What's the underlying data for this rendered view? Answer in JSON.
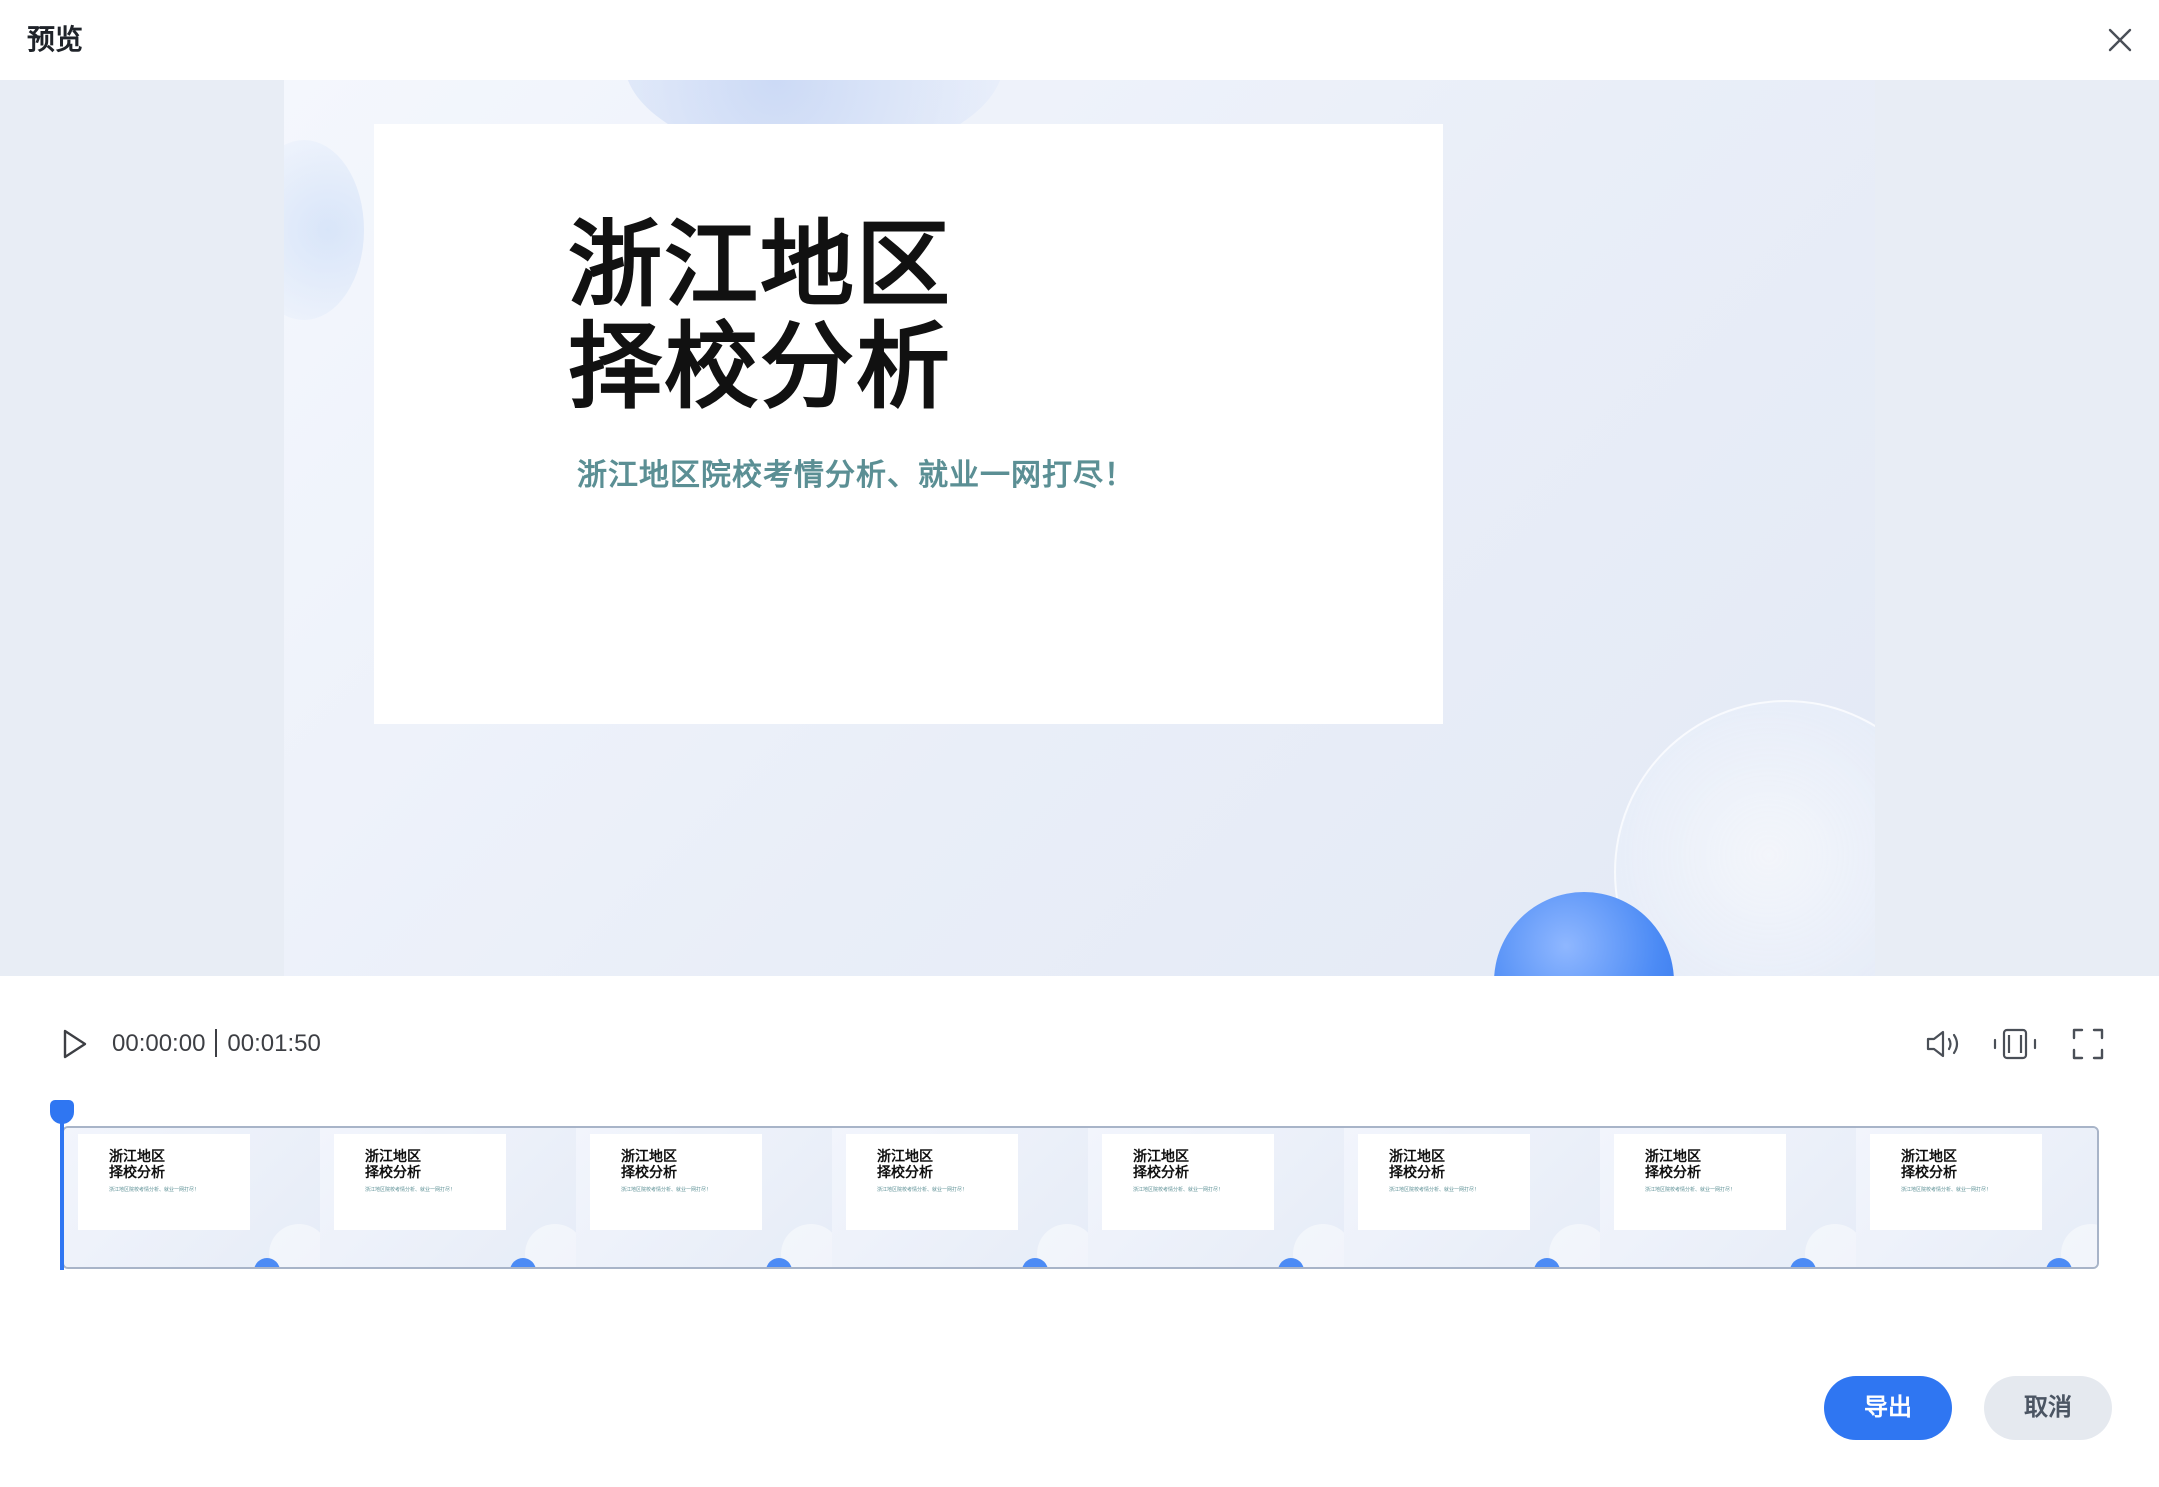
{
  "dialog": {
    "title": "预览"
  },
  "slide": {
    "heading": "浙江地区\n择校分析",
    "subtitle": "浙江地区院校考情分析、就业一网打尽！"
  },
  "player": {
    "current_time": "00:00:00",
    "total_time": "00:01:50",
    "playback_progress": 0
  },
  "timeline": {
    "frames": [
      {
        "title": "浙江地区\n择校分析",
        "subtitle": "浙江地区院校考情分析、就业一网打尽！"
      },
      {
        "title": "浙江地区\n择校分析",
        "subtitle": "浙江地区院校考情分析、就业一网打尽！"
      },
      {
        "title": "浙江地区\n择校分析",
        "subtitle": "浙江地区院校考情分析、就业一网打尽！"
      },
      {
        "title": "浙江地区\n择校分析",
        "subtitle": "浙江地区院校考情分析、就业一网打尽！"
      },
      {
        "title": "浙江地区\n择校分析",
        "subtitle": "浙江地区院校考情分析、就业一网打尽！"
      },
      {
        "title": "浙江地区\n择校分析",
        "subtitle": "浙江地区院校考情分析、就业一网打尽！"
      },
      {
        "title": "浙江地区\n择校分析",
        "subtitle": "浙江地区院校考情分析、就业一网打尽！"
      },
      {
        "title": "浙江地区\n择校分析",
        "subtitle": "浙江地区院校考情分析、就业一网打尽！"
      }
    ]
  },
  "footer": {
    "export_label": "导出",
    "cancel_label": "取消"
  },
  "icons": {
    "close": "close-icon",
    "play": "play-icon",
    "volume": "volume-icon",
    "fit": "fit-screen-icon",
    "fullscreen": "fullscreen-icon"
  },
  "colors": {
    "accent": "#2f76f2",
    "subtitle_teal": "#5b8f94",
    "preview_bg": "#e8edf5"
  }
}
